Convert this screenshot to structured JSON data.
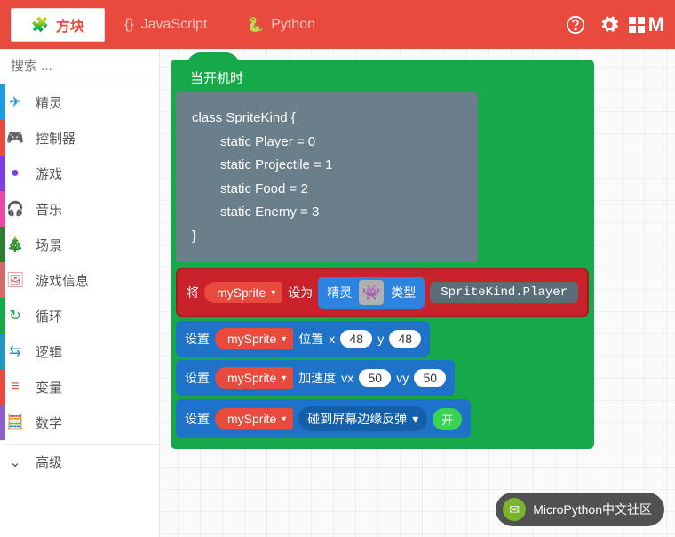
{
  "top": {
    "tab_blocks": "方块",
    "tab_js": "JavaScript",
    "tab_py": "Python",
    "brand_initial": "M"
  },
  "search": {
    "placeholder": "搜索 ..."
  },
  "categories": [
    {
      "icon": "✈",
      "label": "精灵",
      "color": "#1e9be0"
    },
    {
      "icon": "🎮",
      "label": "控制器",
      "color": "#e84a3e"
    },
    {
      "icon": "●",
      "label": "游戏",
      "color": "#7b3fe4"
    },
    {
      "icon": "🎧",
      "label": "音乐",
      "color": "#e84aa0"
    },
    {
      "icon": "🎄",
      "label": "场景",
      "color": "#2e7d32"
    },
    {
      "icon": "🖼",
      "label": "游戏信息",
      "color": "#d16a6a"
    },
    {
      "icon": "↻",
      "label": "循环",
      "color": "#17a849"
    },
    {
      "icon": "⇆",
      "label": "逻辑",
      "color": "#2196c3"
    },
    {
      "icon": "≡",
      "label": "变量",
      "color": "#e84a3e"
    },
    {
      "icon": "🧮",
      "label": "数学",
      "color": "#8a5fc9"
    }
  ],
  "advanced_label": "高级",
  "hat_label": "当开机时",
  "code_lines": [
    "class SpriteKind {",
    "static Player = 0",
    "static Projectile = 1",
    "static Food = 2",
    "static Enemy = 3",
    "}"
  ],
  "set_block": {
    "label_set": "将",
    "var": "mySprite",
    "label_to": "设为",
    "sprite_word": "精灵",
    "type_word": "类型",
    "kind": "SpriteKind.Player"
  },
  "pos_block": {
    "label": "设置",
    "var": "mySprite",
    "word_pos": "位置",
    "x_label": "x",
    "x": "48",
    "y_label": "y",
    "y": "48"
  },
  "acc_block": {
    "label": "设置",
    "var": "mySprite",
    "word_acc": "加速度",
    "vx_label": "vx",
    "vx": "50",
    "vy_label": "vy",
    "vy": "50"
  },
  "bounce_block": {
    "label": "设置",
    "var": "mySprite",
    "option": "碰到屏幕边缘反弹",
    "toggle": "开"
  },
  "toast": {
    "text": "MicroPython中文社区"
  }
}
